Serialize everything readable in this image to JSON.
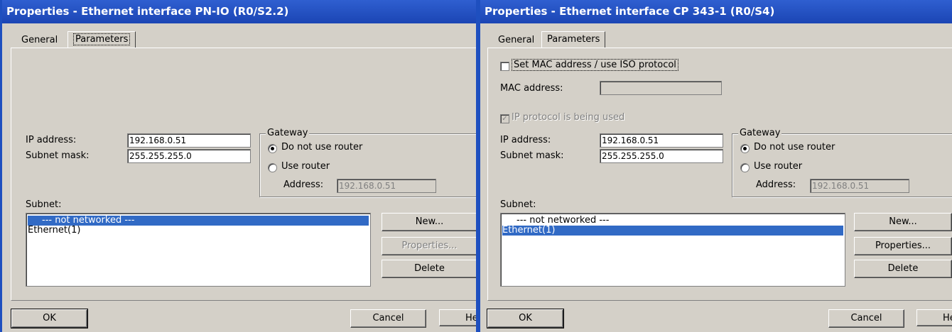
{
  "left": {
    "title": "Properties - Ethernet interface  PN-IO (R0/S2.2)",
    "tabs": [
      "General",
      "Parameters"
    ],
    "ip_label": "IP address:",
    "ip_value": "192.168.0.51",
    "subnet_label": "Subnet mask:",
    "subnet_value": "255.255.255.0",
    "gateway_title": "Gateway",
    "no_router": "Do not use router",
    "use_router": "Use router",
    "address_label": "Address:",
    "address_value": "192.168.0.51",
    "subnet_list_label": "Subnet:",
    "subnet_items": [
      "--- not networked ---",
      "Ethernet(1)"
    ],
    "selected_subnet": "--- not networked ---",
    "new_button": "New...",
    "properties_button": "Properties...",
    "delete_button": "Delete",
    "ok_button": "OK",
    "cancel_button": "Cancel",
    "help_button": "Help"
  },
  "right": {
    "title": "Properties - Ethernet interface  CP 343-1 (R0/S4)",
    "tabs": [
      "General",
      "Parameters"
    ],
    "mac_checkbox": "Set MAC address / use ISO protocol",
    "mac_label": "MAC address:",
    "mac_value": "",
    "ip_protocol": "IP protocol is being used",
    "ip_label": "IP address:",
    "ip_value": "192.168.0.51",
    "subnet_label": "Subnet mask:",
    "subnet_value": "255.255.255.0",
    "gateway_title": "Gateway",
    "no_router": "Do not use router",
    "use_router": "Use router",
    "address_label": "Address:",
    "address_value": "192.168.0.51",
    "subnet_list_label": "Subnet:",
    "subnet_items": [
      "--- not networked ---",
      "Ethernet(1)"
    ],
    "selected_subnet": "Ethernet(1)",
    "new_button": "New...",
    "properties_button": "Properties...",
    "delete_button": "Delete",
    "ok_button": "OK",
    "cancel_button": "Cancel",
    "help_button": "Help"
  },
  "colors": {
    "title_bar": "#1e4fbf",
    "selection": "#316ac5",
    "dialog_face": "#d4d0c8"
  }
}
